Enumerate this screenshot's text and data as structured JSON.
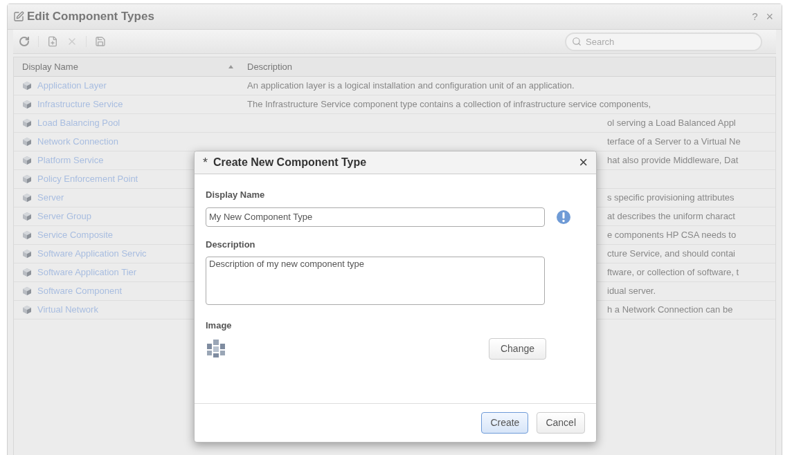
{
  "window": {
    "title": "Edit Component Types",
    "help": "?",
    "close": "×"
  },
  "search": {
    "placeholder": "Search"
  },
  "table": {
    "columns": [
      "Display Name",
      "Description"
    ],
    "rows": [
      {
        "name": "Application Layer",
        "description": "An application layer is a logical installation and configuration unit of an application."
      },
      {
        "name": "Infrastructure Service",
        "description": "The Infrastructure Service component type contains a collection of infrastructure service components,"
      },
      {
        "name": "Load Balancing Pool",
        "description": "ol serving a Load Balanced Appl"
      },
      {
        "name": "Network Connection",
        "description": "terface of a Server to a Virtual Ne"
      },
      {
        "name": "Platform Service",
        "description": "hat also provide Middleware, Dat"
      },
      {
        "name": "Policy Enforcement Point"
      },
      {
        "name": "Server",
        "description": "s specific provisioning attributes"
      },
      {
        "name": "Server Group",
        "description": "at describes the uniform charact"
      },
      {
        "name": "Service Composite",
        "description": "e components HP CSA needs to"
      },
      {
        "name": "Software Application Servic",
        "description": "cture Service, and should contai"
      },
      {
        "name": "Software Application Tier",
        "description": "ftware, or collection of software, t"
      },
      {
        "name": "Software Component",
        "description": "idual server."
      },
      {
        "name": "Virtual Network",
        "description": "h a Network Connection can be"
      }
    ]
  },
  "modal": {
    "mark": "*",
    "title": "Create New Component Type",
    "close": "×",
    "display_name": {
      "label": "Display Name",
      "value": "My New Component Type"
    },
    "description": {
      "label": "Description",
      "value": "Description of my new component type"
    },
    "image": {
      "label": "Image",
      "button": "Change"
    },
    "buttons": [
      "Create",
      "Cancel"
    ]
  }
}
